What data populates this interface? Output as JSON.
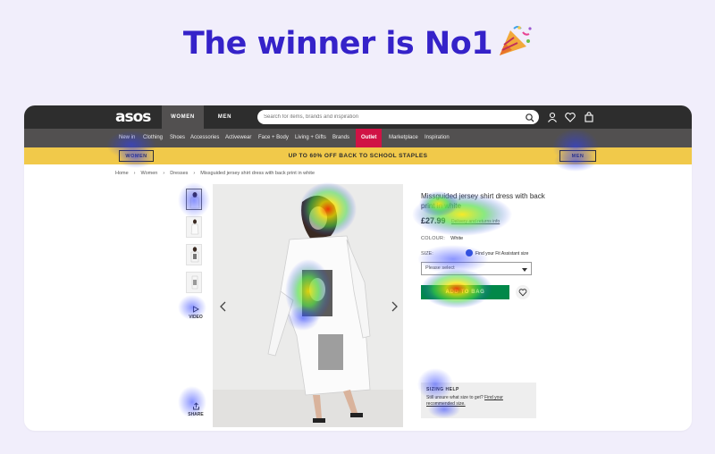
{
  "headline": {
    "text": "The winner is No1",
    "emoji": "party-popper-icon"
  },
  "header": {
    "logo": "asos",
    "gender_tabs": [
      "WOMEN",
      "MEN"
    ],
    "search_placeholder": "Search for items, brands and inspiration",
    "icons": [
      "search-icon",
      "account-icon",
      "heart-icon",
      "bag-icon"
    ]
  },
  "nav": {
    "items": [
      "New in",
      "Clothing",
      "Shoes",
      "Accessories",
      "Activewear",
      "Face + Body",
      "Living + Gifts",
      "Brands",
      "Outlet",
      "Marketplace",
      "Inspiration"
    ]
  },
  "promo": {
    "women_label": "WOMEN",
    "text": "UP TO 60% OFF BACK TO SCHOOL STAPLES",
    "men_label": "MEN"
  },
  "breadcrumb": [
    "Home",
    "›",
    "Women",
    "›",
    "Dresses",
    "›",
    "Missguided jersey shirt dress with back print in white"
  ],
  "gallery": {
    "video_label": "VIDEO",
    "share_label": "SHARE"
  },
  "product": {
    "title": "Missguided jersey shirt dress with back print in white",
    "price": "£27.99",
    "delivery_link": "Delivery and returns info",
    "colour_label": "COLOUR:",
    "colour_value": "White",
    "size_label": "SIZE:",
    "fit_assistant": "Find your Fit Assistant size",
    "size_placeholder": "Please select",
    "add_to_bag": "ADD TO BAG"
  },
  "help": {
    "heading": "SIZING HELP",
    "text": "Still unsure what size to get?",
    "link": "Find your recommended size."
  },
  "colors": {
    "headline": "#3522c9",
    "background": "#f1eefb",
    "topbar": "#2d2d2d",
    "promo": "#f1c94a",
    "outlet": "#d01345",
    "add_to_bag": "#018849"
  }
}
